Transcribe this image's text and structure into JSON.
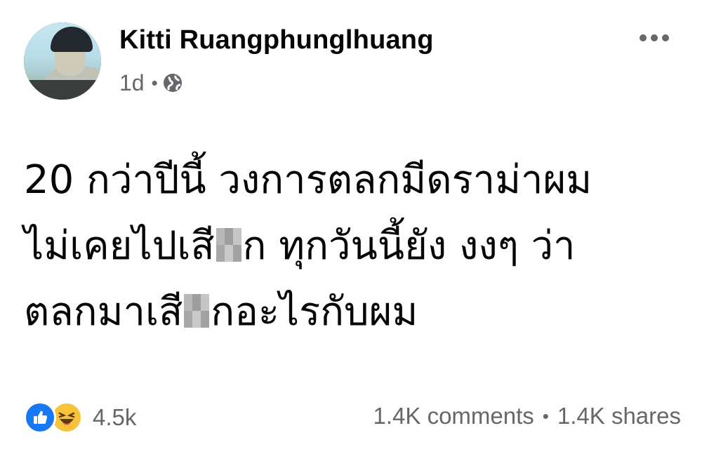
{
  "post": {
    "author": "Kitti Ruangphunglhuang",
    "time": "1d",
    "privacy_icon": "globe-icon",
    "menu_icon": "more-options-icon",
    "text_lines": [
      {
        "before": "20 กว่าปีนี้ วงการตลกมีดราม่าผม",
        "after": ""
      },
      {
        "before": "ไม่เคยไปเสี",
        "after": "ก ทุกวันนี้ยัง งงๆ ว่า"
      },
      {
        "before": "ตลกมาเสี",
        "after": "กอะไรกับผม"
      }
    ]
  },
  "footer": {
    "reaction_icons": [
      "like-icon",
      "haha-icon"
    ],
    "reaction_count": "4.5k",
    "comments": "1.4K comments",
    "separator": "•",
    "shares": "1.4K shares"
  },
  "colors": {
    "like": "#1877f2",
    "haha": "#f7c33b",
    "secondary_text": "#65676b",
    "primary_text": "#050505"
  }
}
